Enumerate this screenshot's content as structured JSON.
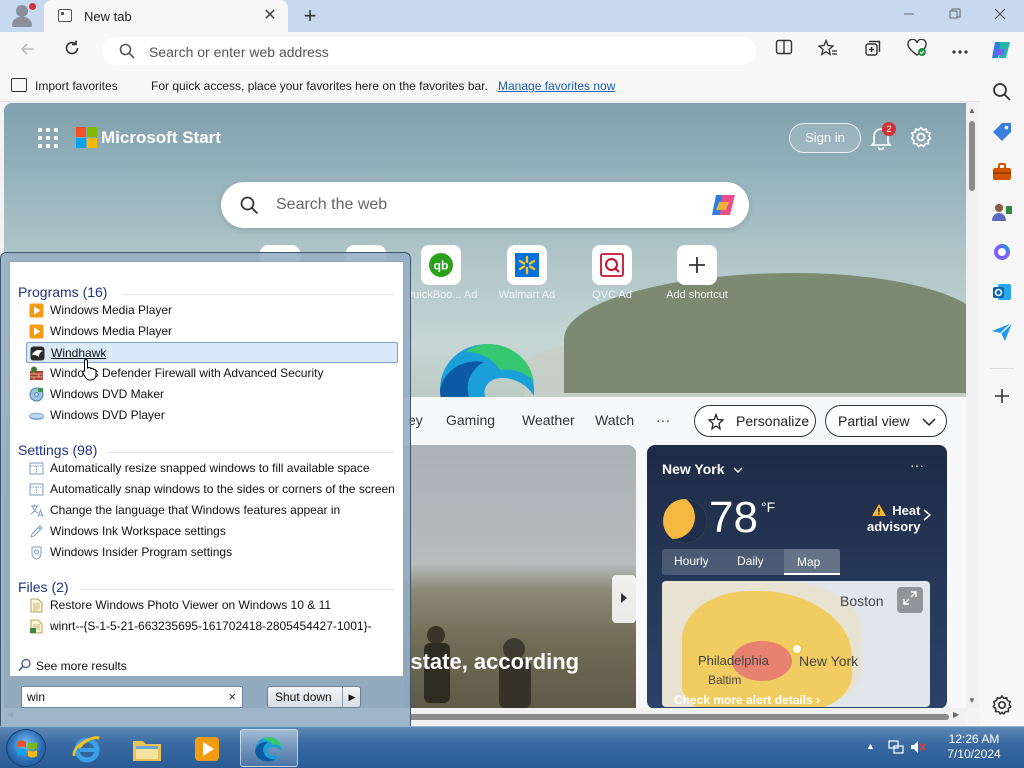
{
  "browser": {
    "tab_title": "New tab",
    "tab_close": "✕",
    "new_tab": "+",
    "address_placeholder": "Search or enter web address",
    "favbar": {
      "import_label": "Import favorites",
      "message": "For quick access, place your favorites here on the favorites bar.",
      "manage_link": "Manage favorites now"
    }
  },
  "page": {
    "brand": "Microsoft Start",
    "signin": "Sign in",
    "notification_count": "2",
    "search_placeholder": "Search the web",
    "shortcuts": [
      {
        "label": "QuickBoo... Ad",
        "icon": "quickbooks-icon"
      },
      {
        "label": "Walmart  Ad",
        "icon": "walmart-icon"
      },
      {
        "label": "QVC  Ad",
        "icon": "qvc-icon"
      },
      {
        "label": "Add shortcut",
        "icon": "plus-icon"
      }
    ],
    "feed_nav": [
      "ey",
      "Gaming",
      "Weather",
      "Watch",
      "···"
    ],
    "personalize": "Personalize",
    "partial_view": "Partial view",
    "story_headline": "y state, according",
    "weather": {
      "city": "New York",
      "more": "···",
      "temperature": "78",
      "unit": "°F",
      "advisory_line1": "Heat",
      "advisory_line2": "advisory",
      "tabs": [
        "Hourly",
        "Daily",
        "Map"
      ],
      "active_tab": "Map",
      "map_labels": {
        "boston": "Boston",
        "new_york": "New York",
        "philadelphia": "Philadelphia",
        "baltimore": "Baltim"
      },
      "alert_link": "Check more alert details"
    }
  },
  "start_menu": {
    "groups": [
      {
        "title": "Programs (16)",
        "items": [
          {
            "label": "Windows Media Player",
            "icon": "media-player-icon"
          },
          {
            "label": "Windows Media Player",
            "icon": "media-player-icon"
          },
          {
            "label": "Windhawk",
            "icon": "windhawk-icon",
            "highlighted": true
          },
          {
            "label": "Windows Defender Firewall with Advanced Security",
            "icon": "firewall-icon"
          },
          {
            "label": "Windows DVD Maker",
            "icon": "dvd-maker-icon"
          },
          {
            "label": "Windows DVD Player",
            "icon": "dvd-player-icon"
          }
        ]
      },
      {
        "title": "Settings (98)",
        "items": [
          {
            "label": "Automatically resize snapped windows to fill available space",
            "icon": "settings-window-icon"
          },
          {
            "label": "Automatically snap windows to the sides or corners of the screen",
            "icon": "settings-window-icon"
          },
          {
            "label": "Change the language that Windows features appear in",
            "icon": "language-icon"
          },
          {
            "label": "Windows Ink Workspace settings",
            "icon": "pen-icon"
          },
          {
            "label": "Windows Insider Program settings",
            "icon": "insider-icon"
          }
        ]
      },
      {
        "title": "Files (2)",
        "items": [
          {
            "label": "Restore Windows Photo Viewer on Windows 10 & 11",
            "icon": "file-icon"
          },
          {
            "label": "winrt--{S-1-5-21-663235695-161702418-2805454427-1001}-",
            "icon": "file-icon"
          }
        ]
      }
    ],
    "see_more": "See more results",
    "search_value": "win",
    "search_clear": "×",
    "shutdown": "Shut down",
    "shutdown_arrow": "▶"
  },
  "taskbar": {
    "time": "12:26 AM",
    "date": "7/10/2024",
    "apps": [
      "internet-explorer-icon",
      "file-explorer-icon",
      "media-player-icon",
      "edge-icon"
    ]
  },
  "colors": {
    "accent_blue": "#1a5fb4",
    "start_menu_group": "#1e3287",
    "notification_badge": "#d13438",
    "taskbar": "#2b5b94"
  }
}
